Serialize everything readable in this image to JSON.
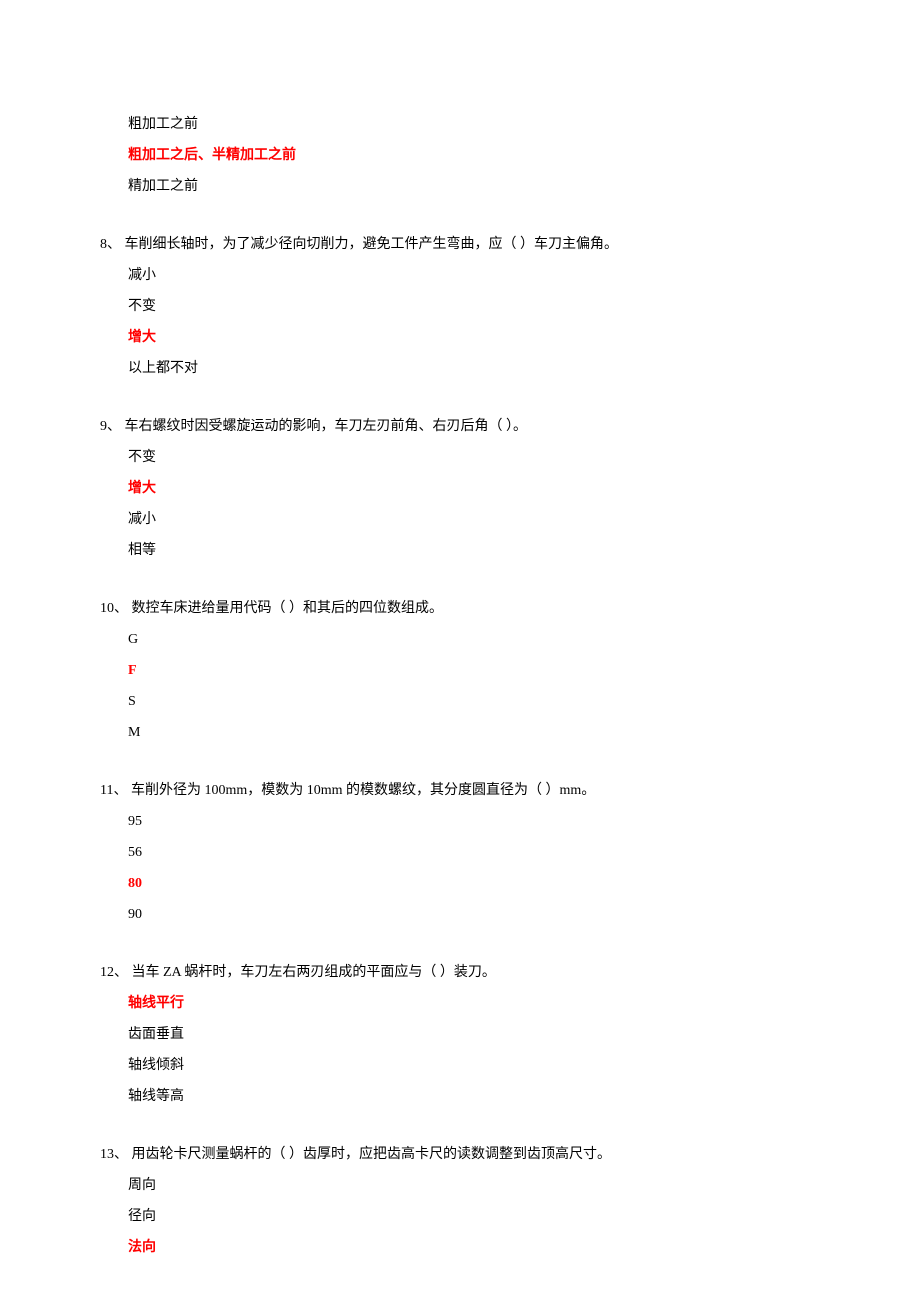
{
  "q7": {
    "options": [
      {
        "text": "粗加工之前",
        "correct": false
      },
      {
        "text": "粗加工之后、半精加工之前",
        "correct": true
      },
      {
        "text": "精加工之前",
        "correct": false
      }
    ]
  },
  "q8": {
    "num": "8、",
    "text": " 车削细长轴时，为了减少径向切削力，避免工件产生弯曲，应（ ）车刀主偏角。",
    "options": [
      {
        "text": "减小",
        "correct": false
      },
      {
        "text": "不变",
        "correct": false
      },
      {
        "text": "增大",
        "correct": true
      },
      {
        "text": "以上都不对",
        "correct": false
      }
    ]
  },
  "q9": {
    "num": "9、",
    "text": " 车右螺纹时因受螺旋运动的影响，车刀左刃前角、右刃后角（ ）。",
    "options": [
      {
        "text": "不变",
        "correct": false
      },
      {
        "text": "增大",
        "correct": true
      },
      {
        "text": "减小",
        "correct": false
      },
      {
        "text": "相等",
        "correct": false
      }
    ]
  },
  "q10": {
    "num": "10、",
    "text": "  数控车床进给量用代码（ ）和其后的四位数组成。",
    "options": [
      {
        "text": "G",
        "correct": false
      },
      {
        "text": "F",
        "correct": true
      },
      {
        "text": "S",
        "correct": false
      },
      {
        "text": "M",
        "correct": false
      }
    ]
  },
  "q11": {
    "num": "11、",
    "text": "  车削外径为 100mm，模数为 10mm 的模数螺纹，其分度圆直径为（ ）mm。",
    "options": [
      {
        "text": "95",
        "correct": false
      },
      {
        "text": "56",
        "correct": false
      },
      {
        "text": "80",
        "correct": true
      },
      {
        "text": "90",
        "correct": false
      }
    ]
  },
  "q12": {
    "num": "12、",
    "text": "  当车 ZA 蜗杆时，车刀左右两刃组成的平面应与（ ）装刀。",
    "options": [
      {
        "text": "轴线平行",
        "correct": true
      },
      {
        "text": "齿面垂直",
        "correct": false
      },
      {
        "text": "轴线倾斜",
        "correct": false
      },
      {
        "text": "轴线等高",
        "correct": false
      }
    ]
  },
  "q13": {
    "num": "13、",
    "text": "  用齿轮卡尺测量蜗杆的（ ）齿厚时，应把齿高卡尺的读数调整到齿顶高尺寸。",
    "options": [
      {
        "text": "周向",
        "correct": false
      },
      {
        "text": "径向",
        "correct": false
      },
      {
        "text": "法向",
        "correct": true
      }
    ]
  }
}
